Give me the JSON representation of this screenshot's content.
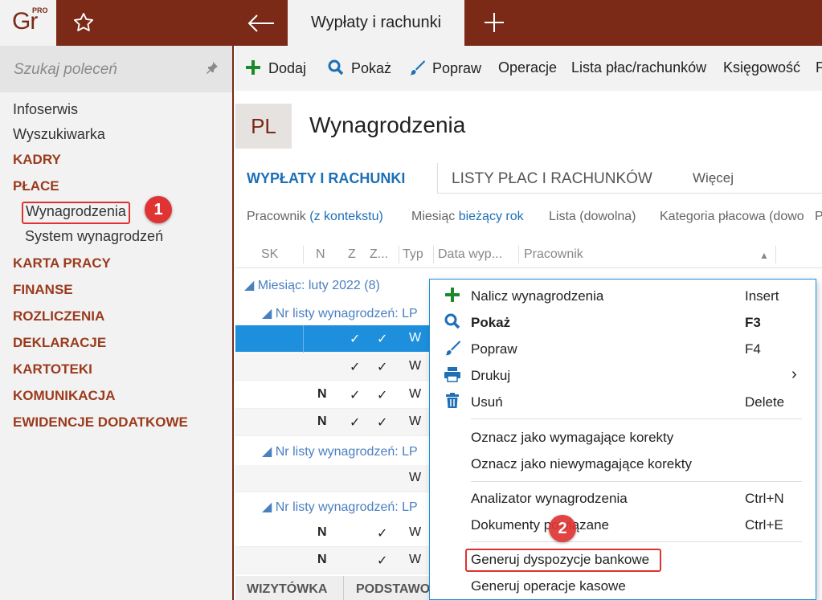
{
  "app": {
    "logo_text": "Gr",
    "logo_pro": "PRO",
    "active_tab": "Wypłaty i rachunki"
  },
  "sidebar": {
    "search_placeholder": "Szukaj poleceń",
    "items": [
      {
        "label": "Infoserwis",
        "type": "link"
      },
      {
        "label": "Wyszukiwarka",
        "type": "link"
      },
      {
        "label": "KADRY",
        "type": "section"
      },
      {
        "label": "PŁACE",
        "type": "section"
      },
      {
        "label": "Wynagrodzenia",
        "type": "sub"
      },
      {
        "label": "System wynagrodzeń",
        "type": "sub"
      },
      {
        "label": "KARTA PRACY",
        "type": "section"
      },
      {
        "label": "FINANSE",
        "type": "section"
      },
      {
        "label": "ROZLICZENIA",
        "type": "section"
      },
      {
        "label": "DEKLARACJE",
        "type": "section"
      },
      {
        "label": "KARTOTEKI",
        "type": "section"
      },
      {
        "label": "KOMUNIKACJA",
        "type": "section"
      },
      {
        "label": "EWIDENCJE DODATKOWE",
        "type": "section"
      }
    ]
  },
  "badges": {
    "one": "1",
    "two": "2"
  },
  "toolbar": {
    "add": "Dodaj",
    "show": "Pokaż",
    "edit": "Popraw",
    "operations": "Operacje",
    "payroll_list": "Lista płac/rachunków",
    "accounting": "Księgowość",
    "more": "P"
  },
  "page": {
    "badge": "PL",
    "title": "Wynagrodzenia"
  },
  "tabs": {
    "t1": "WYPŁATY I RACHUNKI",
    "t2": "LISTY PŁAC I RACHUNKÓW",
    "t3": "Więcej"
  },
  "filters": {
    "f1_label": "Pracownik",
    "f1_value": "(z kontekstu)",
    "f2_label": "Miesiąc",
    "f2_value": "bieżący rok",
    "f3_label": "Lista (dowolna)",
    "f4_label": "Kategoria płacowa (dowo",
    "f5_label": "P"
  },
  "grid": {
    "columns": [
      "SK",
      "N",
      "Z",
      "Z...",
      "Typ",
      "Data wyp...",
      "Pracownik"
    ],
    "group_month": "◢ Miesiąc: luty 2022 (8)",
    "group_list": "◢ Nr listy wynagrodzeń: LP",
    "rows": [
      {
        "n": "",
        "z": "✓",
        "z2": "✓",
        "typ": "W"
      },
      {
        "n": "",
        "z": "✓",
        "z2": "✓",
        "typ": "W"
      },
      {
        "n": "N",
        "z": "✓",
        "z2": "✓",
        "typ": "W"
      },
      {
        "n": "N",
        "z": "✓",
        "z2": "✓",
        "typ": "W"
      },
      {
        "n": "",
        "z": "",
        "z2": "",
        "typ": "W"
      },
      {
        "n": "N",
        "z": "",
        "z2": "✓",
        "typ": "W"
      },
      {
        "n": "N",
        "z": "",
        "z2": "✓",
        "typ": "W"
      }
    ]
  },
  "bottom_tabs": {
    "b1": "WIZYTÓWKA",
    "b2": "PODSTAWO"
  },
  "context_menu": [
    {
      "label": "Nalicz wynagrodzenia",
      "shortcut": "Insert",
      "icon": "plus-icon"
    },
    {
      "label": "Pokaż",
      "shortcut": "F3",
      "icon": "search-icon",
      "bold": true
    },
    {
      "label": "Popraw",
      "shortcut": "F4",
      "icon": "brush-icon"
    },
    {
      "label": "Drukuj",
      "shortcut": "›",
      "icon": "printer-icon"
    },
    {
      "label": "Usuń",
      "shortcut": "Delete",
      "icon": "trash-icon"
    },
    {
      "label": "Oznacz jako wymagające korekty",
      "shortcut": ""
    },
    {
      "label": "Oznacz jako niewymagające korekty",
      "shortcut": ""
    },
    {
      "label": "Analizator wynagrodzenia",
      "shortcut": "Ctrl+N"
    },
    {
      "label": "Dokumenty powiązane",
      "shortcut": "Ctrl+E"
    },
    {
      "label": "Generuj dyspozycje bankowe",
      "shortcut": ""
    },
    {
      "label": "Generuj operacje kasowe",
      "shortcut": ""
    }
  ],
  "colors": {
    "brand": "#7a2a17",
    "accent": "#1e8fdc",
    "highlight": "#e03030",
    "section": "#9b3a1c"
  }
}
